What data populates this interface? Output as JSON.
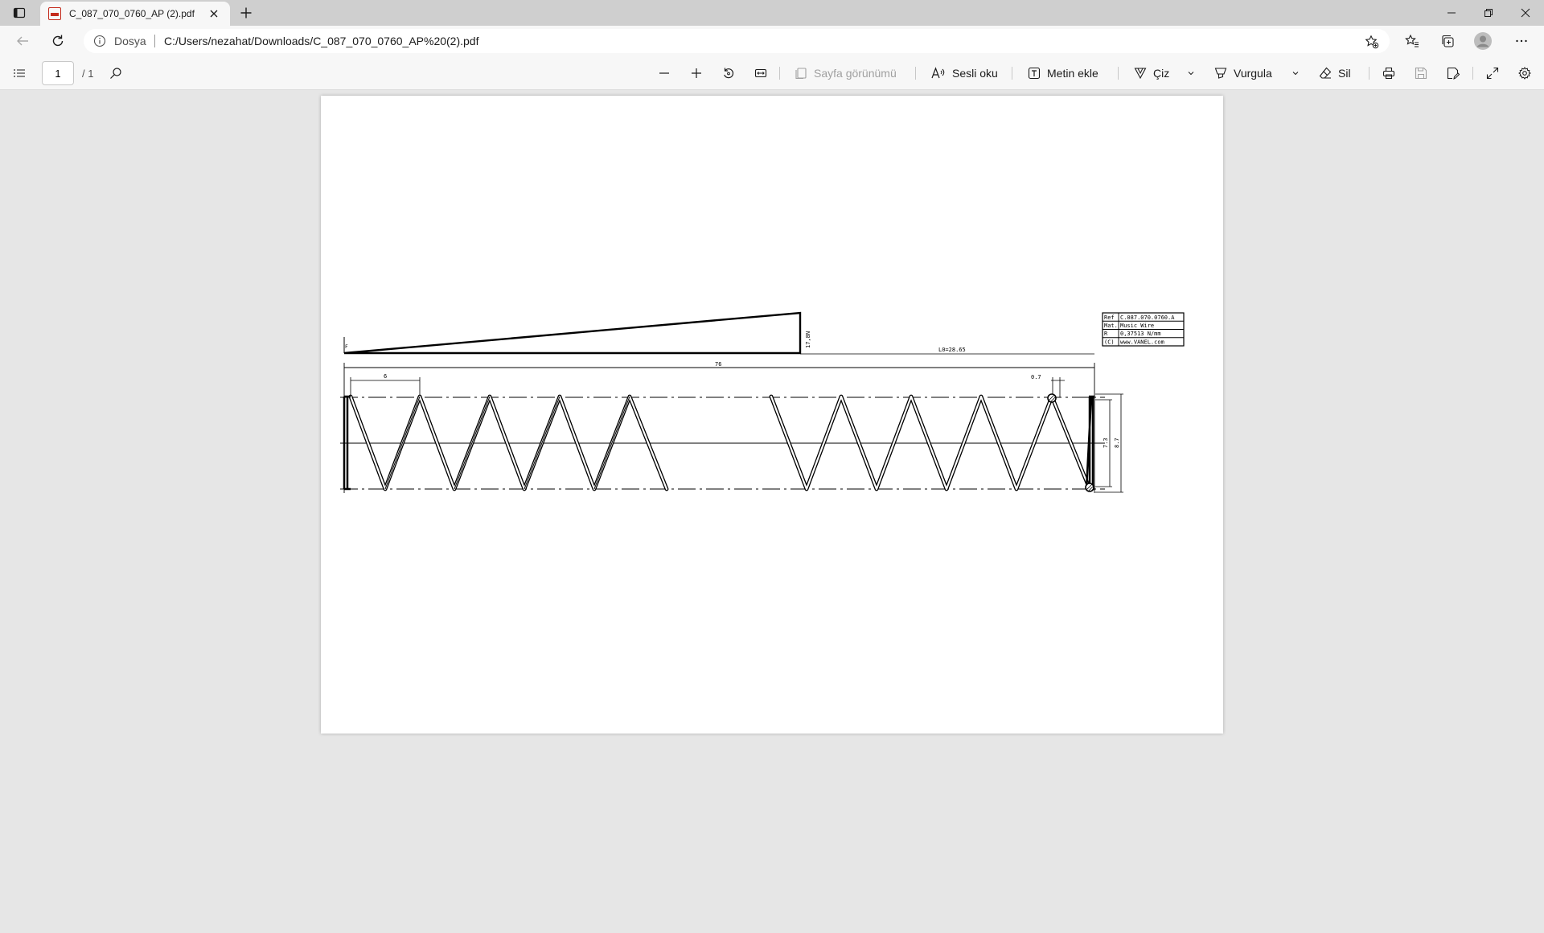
{
  "tab": {
    "title": "C_087_070_0760_AP (2).pdf"
  },
  "address": {
    "site_label": "Dosya",
    "url": "C:/Users/nezahat/Downloads/C_087_070_0760_AP%20(2).pdf"
  },
  "toolbar": {
    "page_current": "1",
    "page_total": "/ 1",
    "page_view_label": "Sayfa görünümü",
    "read_aloud_label": "Sesli oku",
    "add_text_label": "Metin ekle",
    "draw_label": "Çiz",
    "highlight_label": "Vurgula",
    "erase_label": "Sil"
  },
  "drawing": {
    "force_label": "17,8N",
    "free_length_label": "L0=28.65",
    "overall_length_label": "76",
    "pitch_label": "6",
    "wire_label": "0.7",
    "inner_dia_label": "7.3",
    "outer_dia_label": "8.7",
    "force_axis_label": "F",
    "info_table": [
      {
        "key": "Ref",
        "value": "C.087.070.0760.A"
      },
      {
        "key": "Mat.",
        "value": "Music Wire"
      },
      {
        "key": "R",
        "value": "0,37513 N/mm"
      },
      {
        "key": "(C)",
        "value": "www.VANEL.com"
      }
    ]
  },
  "icons": {
    "window_menu": "window-menu-icon",
    "new_tab": "plus-icon",
    "back": "back-arrow-icon",
    "refresh": "refresh-icon",
    "info": "info-icon",
    "favorite": "star-add-icon",
    "favorites": "favorites-icon",
    "collections": "collections-icon",
    "profile": "profile-icon",
    "more": "more-icon",
    "contents": "list-icon",
    "search": "search-icon",
    "zoom_out": "minus-icon",
    "zoom_in": "plus-icon",
    "rotate": "rotate-icon",
    "fit": "fit-width-icon",
    "print": "print-icon",
    "save": "save-icon",
    "save_as": "save-as-icon",
    "fullscreen": "fullscreen-icon",
    "settings": "gear-icon"
  }
}
